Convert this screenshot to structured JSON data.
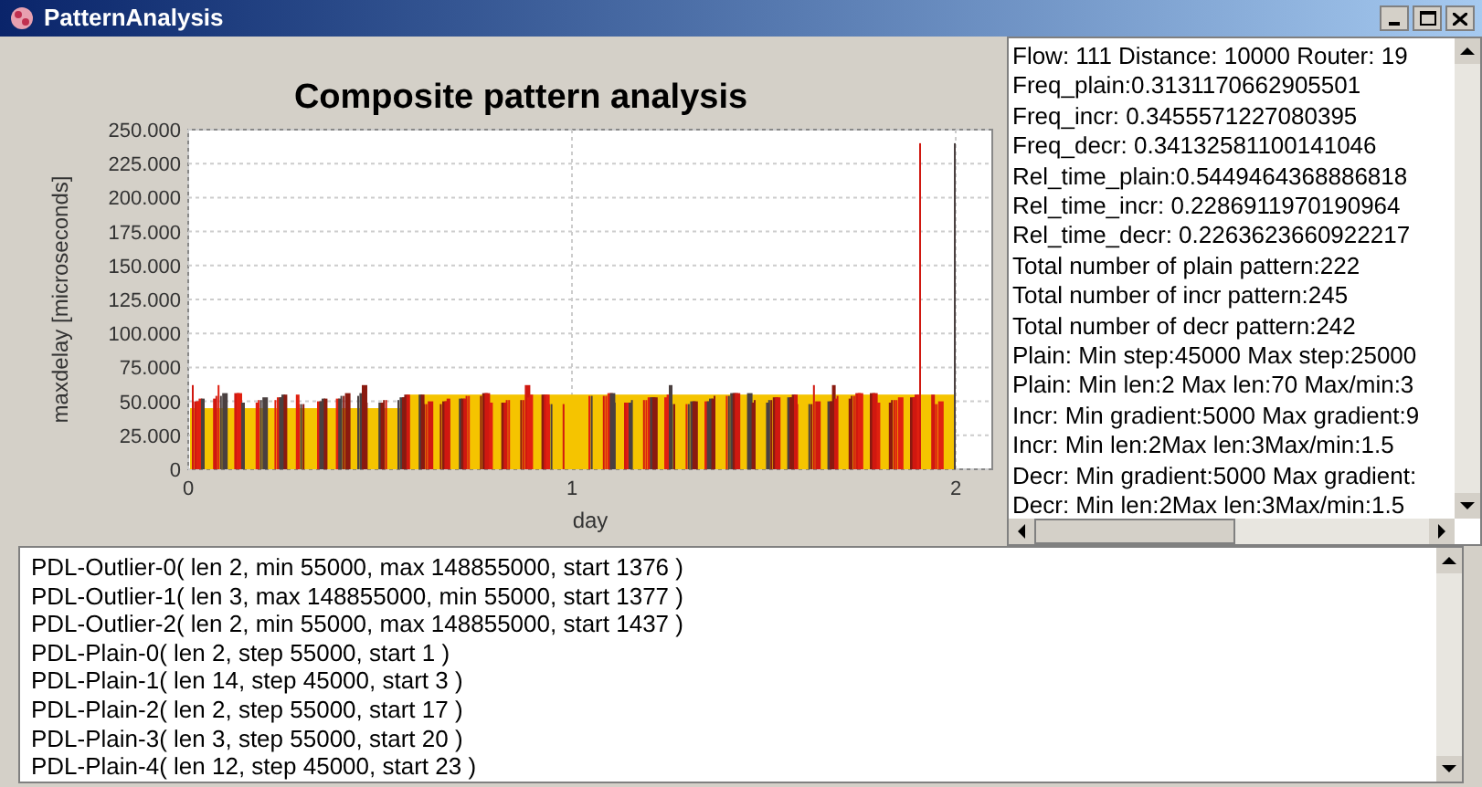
{
  "window": {
    "title": "PatternAnalysis"
  },
  "chart": {
    "title": "Composite pattern analysis",
    "ylabel": "maxdelay [microseconds]",
    "xlabel": "day",
    "yticks": [
      "250.000",
      "225.000",
      "200.000",
      "175.000",
      "150.000",
      "125.000",
      "100.000",
      "75.000",
      "50.000",
      "25.000",
      "0"
    ],
    "xticks": [
      "0",
      "1",
      "2"
    ]
  },
  "stats_lines": [
    "Flow: 111 Distance: 10000 Router: 19",
    "Freq_plain:0.3131170662905501",
    "Freq_incr: 0.3455571227080395",
    "Freq_decr: 0.34132581100141046",
    "Rel_time_plain:0.5449464368886818",
    "Rel_time_incr: 0.2286911970190964",
    "Rel_time_decr: 0.2263623660922217",
    "Total number of plain pattern:222",
    "Total number of incr pattern:245",
    "Total number of decr pattern:242",
    "Plain: Min step:45000 Max step:25000",
    "Plain: Min len:2   Max len:70 Max/min:3",
    "Incr: Min gradient:5000 Max gradient:9",
    "Incr: Min len:2Max len:3Max/min:1.5",
    "Decr: Min gradient:5000 Max gradient:",
    "Decr: Min len:2Max len:3Max/min:1.5"
  ],
  "pattern_list": [
    "PDL-Outlier-0(  len 2, min 55000, max 148855000, start 1376 )",
    "PDL-Outlier-1( len 3, max 148855000, min 55000, start 1377 )",
    "PDL-Outlier-2(  len 2, min 55000, max 148855000, start 1437 )",
    "PDL-Plain-0( len 2, step 55000, start 1 )",
    "PDL-Plain-1( len 14, step 45000, start 3 )",
    "PDL-Plain-2( len 2, step 55000, start 17 )",
    "PDL-Plain-3( len 3, step 55000, start 20 )",
    "PDL-Plain-4( len 12, step 45000, start 23 )"
  ]
}
